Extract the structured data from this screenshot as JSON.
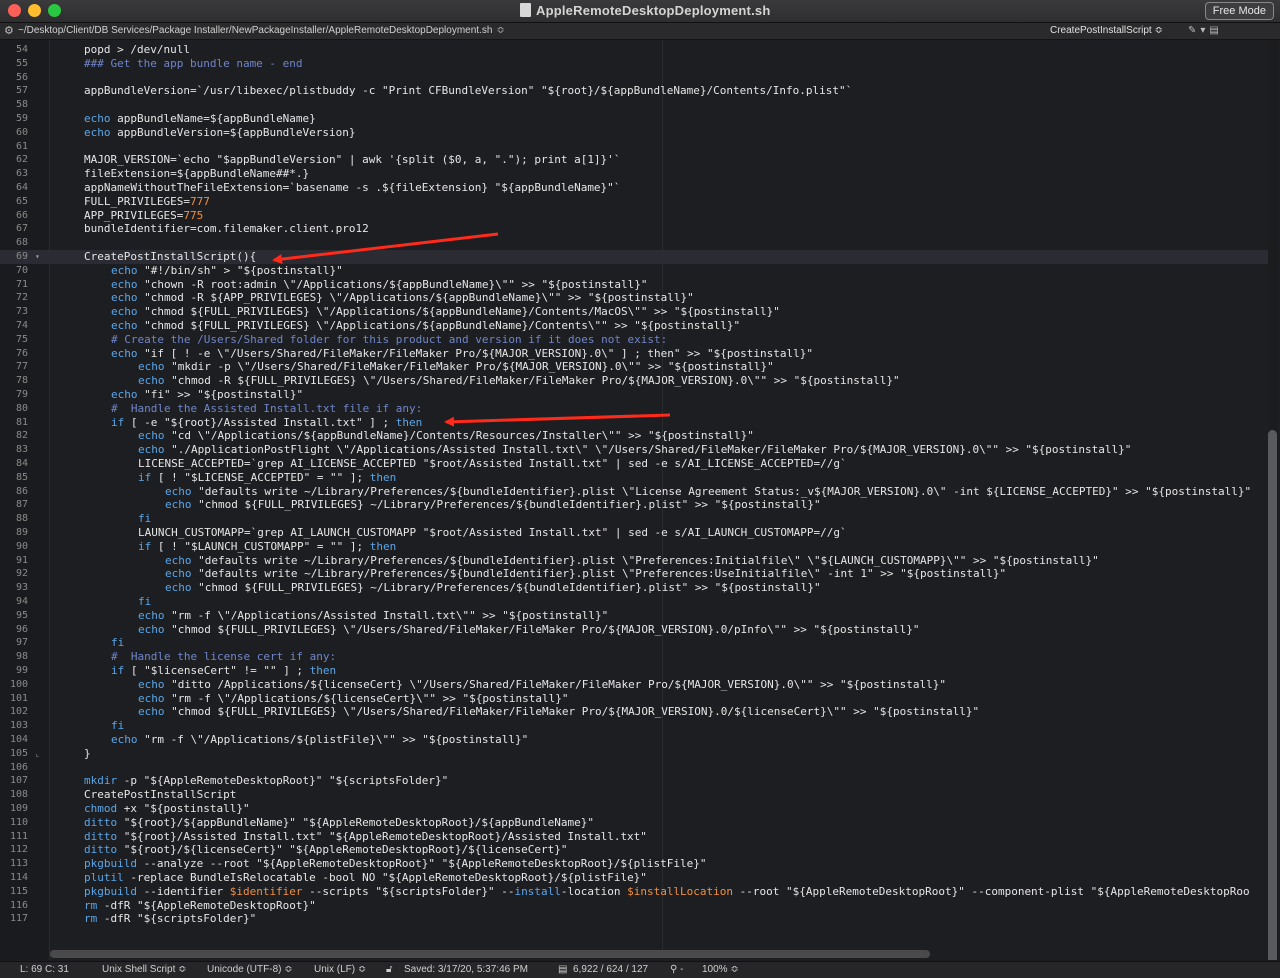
{
  "window": {
    "title": "AppleRemoteDesktopDeployment.sh",
    "free_mode_label": "Free Mode",
    "colors": {
      "close": "#fe5f57",
      "minimize": "#febc2e",
      "maximize": "#28c840"
    }
  },
  "pathbar": {
    "path": "~/Desktop/Client/DB Services/Package Installer/NewPackageInstaller/AppleRemoteDesktopDeployment.sh",
    "function_menu": "CreatePostInstallScript",
    "icons": [
      "gear-icon",
      "bookmark-icon",
      "text-options-icon",
      "split-view-icon"
    ]
  },
  "editor": {
    "current_line": 69,
    "syntax_colors": {
      "keyword": "#5aa6e8",
      "comment": "#6f86c9",
      "number": "#f2903a",
      "text": "#cfcfcf"
    },
    "lines": [
      {
        "n": 54,
        "i": 2,
        "segs": [
          [
            "p",
            "popd > /dev/null"
          ]
        ]
      },
      {
        "n": 55,
        "i": 2,
        "segs": [
          [
            "c",
            "### Get the app bundle name - end"
          ]
        ]
      },
      {
        "n": 56,
        "i": 2,
        "segs": []
      },
      {
        "n": 57,
        "i": 2,
        "segs": [
          [
            "p",
            "appBundleVersion=`/usr/libexec/plistbuddy -c \"Print CFBundleVersion\" \"${root}/${appBundleName}/Contents/Info.plist\"`"
          ]
        ]
      },
      {
        "n": 58,
        "i": 2,
        "segs": []
      },
      {
        "n": 59,
        "i": 2,
        "segs": [
          [
            "k",
            "echo"
          ],
          [
            "p",
            " appBundleName=${appBundleName}"
          ]
        ]
      },
      {
        "n": 60,
        "i": 2,
        "segs": [
          [
            "k",
            "echo"
          ],
          [
            "p",
            " appBundleVersion=${appBundleVersion}"
          ]
        ]
      },
      {
        "n": 61,
        "i": 2,
        "segs": []
      },
      {
        "n": 62,
        "i": 2,
        "segs": [
          [
            "p",
            "MAJOR_VERSION=`echo \"$appBundleVersion\" | awk '{split ($0, a, \".\"); print a[1]}'`"
          ]
        ]
      },
      {
        "n": 63,
        "i": 2,
        "segs": [
          [
            "p",
            "fileExtension=${appBundleName##*.}"
          ]
        ]
      },
      {
        "n": 64,
        "i": 2,
        "segs": [
          [
            "p",
            "appNameWithoutTheFileExtension=`basename -s .${fileExtension} \"${appBundleName}\"`"
          ]
        ]
      },
      {
        "n": 65,
        "i": 2,
        "segs": [
          [
            "p",
            "FULL_PRIVILEGES="
          ],
          [
            "n",
            "777"
          ]
        ]
      },
      {
        "n": 66,
        "i": 2,
        "segs": [
          [
            "p",
            "APP_PRIVILEGES="
          ],
          [
            "n",
            "775"
          ]
        ]
      },
      {
        "n": 67,
        "i": 2,
        "segs": [
          [
            "p",
            "bundleIdentifier=com.filemaker.client.pro12"
          ]
        ]
      },
      {
        "n": 68,
        "i": 2,
        "segs": []
      },
      {
        "n": 69,
        "i": 2,
        "fold": "▾",
        "segs": [
          [
            "p",
            "CreatePostInstallScript(){"
          ]
        ]
      },
      {
        "n": 70,
        "i": 3,
        "segs": [
          [
            "k",
            "echo"
          ],
          [
            "p",
            " \"#!/bin/sh\" > \"${postinstall}\""
          ]
        ]
      },
      {
        "n": 71,
        "i": 3,
        "segs": [
          [
            "k",
            "echo"
          ],
          [
            "p",
            " \"chown -R root:admin \\\"/Applications/${appBundleName}\\\"\" >> \"${postinstall}\""
          ]
        ]
      },
      {
        "n": 72,
        "i": 3,
        "segs": [
          [
            "k",
            "echo"
          ],
          [
            "p",
            " \"chmod -R ${APP_PRIVILEGES} \\\"/Applications/${appBundleName}\\\"\" >> \"${postinstall}\""
          ]
        ]
      },
      {
        "n": 73,
        "i": 3,
        "segs": [
          [
            "k",
            "echo"
          ],
          [
            "p",
            " \"chmod ${FULL_PRIVILEGES} \\\"/Applications/${appBundleName}/Contents/MacOS\\\"\" >> \"${postinstall}\""
          ]
        ]
      },
      {
        "n": 74,
        "i": 3,
        "segs": [
          [
            "k",
            "echo"
          ],
          [
            "p",
            " \"chmod ${FULL_PRIVILEGES} \\\"/Applications/${appBundleName}/Contents\\\"\" >> \"${postinstall}\""
          ]
        ]
      },
      {
        "n": 75,
        "i": 3,
        "segs": [
          [
            "c",
            "# Create the /Users/Shared folder for this product and version if it does not exist:"
          ]
        ]
      },
      {
        "n": 76,
        "i": 3,
        "segs": [
          [
            "k",
            "echo"
          ],
          [
            "p",
            " \"if [ ! -e \\\"/Users/Shared/FileMaker/FileMaker Pro/${MAJOR_VERSION}.0\\\" ] ; then\" >> \"${postinstall}\""
          ]
        ]
      },
      {
        "n": 77,
        "i": 4,
        "segs": [
          [
            "k",
            "echo"
          ],
          [
            "p",
            " \"mkdir -p \\\"/Users/Shared/FileMaker/FileMaker Pro/${MAJOR_VERSION}.0\\\"\" >> \"${postinstall}\""
          ]
        ]
      },
      {
        "n": 78,
        "i": 4,
        "segs": [
          [
            "k",
            "echo"
          ],
          [
            "p",
            " \"chmod -R ${FULL_PRIVILEGES} \\\"/Users/Shared/FileMaker/FileMaker Pro/${MAJOR_VERSION}.0\\\"\" >> \"${postinstall}\""
          ]
        ]
      },
      {
        "n": 79,
        "i": 3,
        "segs": [
          [
            "k",
            "echo"
          ],
          [
            "p",
            " \"fi\" >> \"${postinstall}\""
          ]
        ]
      },
      {
        "n": 80,
        "i": 3,
        "segs": [
          [
            "c",
            "#  Handle the Assisted Install.txt file if any:"
          ]
        ]
      },
      {
        "n": 81,
        "i": 3,
        "segs": [
          [
            "k",
            "if"
          ],
          [
            "p",
            " [ -e \"${root}/Assisted Install.txt\" ] ; "
          ],
          [
            "k",
            "then"
          ]
        ]
      },
      {
        "n": 82,
        "i": 4,
        "segs": [
          [
            "k",
            "echo"
          ],
          [
            "p",
            " \"cd \\\"/Applications/${appBundleName}/Contents/Resources/Installer\\\"\" >> \"${postinstall}\""
          ]
        ]
      },
      {
        "n": 83,
        "i": 4,
        "segs": [
          [
            "k",
            "echo"
          ],
          [
            "p",
            " \"./ApplicationPostFlight \\\"/Applications/Assisted Install.txt\\\" \\\"/Users/Shared/FileMaker/FileMaker Pro/${MAJOR_VERSION}.0\\\"\" >> \"${postinstall}\""
          ]
        ]
      },
      {
        "n": 84,
        "i": 4,
        "segs": [
          [
            "p",
            "LICENSE_ACCEPTED=`grep AI_LICENSE_ACCEPTED \"$root/Assisted Install.txt\" | sed -e s/AI_LICENSE_ACCEPTED=//g`"
          ]
        ]
      },
      {
        "n": 85,
        "i": 4,
        "segs": [
          [
            "k",
            "if"
          ],
          [
            "p",
            " [ ! \"$LICENSE_ACCEPTED\" = \"\" ]; "
          ],
          [
            "k",
            "then"
          ]
        ]
      },
      {
        "n": 86,
        "i": 5,
        "segs": [
          [
            "k",
            "echo"
          ],
          [
            "p",
            " \"defaults write ~/Library/Preferences/${bundleIdentifier}.plist \\\"License Agreement Status:_v${MAJOR_VERSION}.0\\\" -int ${LICENSE_ACCEPTED}\" >> \"${postinstall}\""
          ]
        ]
      },
      {
        "n": 87,
        "i": 5,
        "segs": [
          [
            "k",
            "echo"
          ],
          [
            "p",
            " \"chmod ${FULL_PRIVILEGES} ~/Library/Preferences/${bundleIdentifier}.plist\" >> \"${postinstall}\""
          ]
        ]
      },
      {
        "n": 88,
        "i": 4,
        "segs": [
          [
            "k",
            "fi"
          ]
        ]
      },
      {
        "n": 89,
        "i": 4,
        "segs": [
          [
            "p",
            "LAUNCH_CUSTOMAPP=`grep AI_LAUNCH_CUSTOMAPP \"$root/Assisted Install.txt\" | sed -e s/AI_LAUNCH_CUSTOMAPP=//g`"
          ]
        ]
      },
      {
        "n": 90,
        "i": 4,
        "segs": [
          [
            "k",
            "if"
          ],
          [
            "p",
            " [ ! \"$LAUNCH_CUSTOMAPP\" = \"\" ]; "
          ],
          [
            "k",
            "then"
          ]
        ]
      },
      {
        "n": 91,
        "i": 5,
        "segs": [
          [
            "k",
            "echo"
          ],
          [
            "p",
            " \"defaults write ~/Library/Preferences/${bundleIdentifier}.plist \\\"Preferences:Initialfile\\\" \\\"${LAUNCH_CUSTOMAPP}\\\"\" >> \"${postinstall}\""
          ]
        ]
      },
      {
        "n": 92,
        "i": 5,
        "segs": [
          [
            "k",
            "echo"
          ],
          [
            "p",
            " \"defaults write ~/Library/Preferences/${bundleIdentifier}.plist \\\"Preferences:UseInitialfile\\\" -int 1\" >> \"${postinstall}\""
          ]
        ]
      },
      {
        "n": 93,
        "i": 5,
        "segs": [
          [
            "k",
            "echo"
          ],
          [
            "p",
            " \"chmod ${FULL_PRIVILEGES} ~/Library/Preferences/${bundleIdentifier}.plist\" >> \"${postinstall}\""
          ]
        ]
      },
      {
        "n": 94,
        "i": 4,
        "segs": [
          [
            "k",
            "fi"
          ]
        ]
      },
      {
        "n": 95,
        "i": 4,
        "segs": [
          [
            "k",
            "echo"
          ],
          [
            "p",
            " \"rm -f \\\"/Applications/Assisted Install.txt\\\"\" >> \"${postinstall}\""
          ]
        ]
      },
      {
        "n": 96,
        "i": 4,
        "segs": [
          [
            "k",
            "echo"
          ],
          [
            "p",
            " \"chmod ${FULL_PRIVILEGES} \\\"/Users/Shared/FileMaker/FileMaker Pro/${MAJOR_VERSION}.0/pInfo\\\"\" >> \"${postinstall}\""
          ]
        ]
      },
      {
        "n": 97,
        "i": 3,
        "segs": [
          [
            "k",
            "fi"
          ]
        ]
      },
      {
        "n": 98,
        "i": 3,
        "segs": [
          [
            "c",
            "#  Handle the license cert if any:"
          ]
        ]
      },
      {
        "n": 99,
        "i": 3,
        "segs": [
          [
            "k",
            "if"
          ],
          [
            "p",
            " [ \"$licenseCert\" != \"\" ] ; "
          ],
          [
            "k",
            "then"
          ]
        ]
      },
      {
        "n": 100,
        "i": 4,
        "segs": [
          [
            "k",
            "echo"
          ],
          [
            "p",
            " \"ditto /Applications/${licenseCert} \\\"/Users/Shared/FileMaker/FileMaker Pro/${MAJOR_VERSION}.0\\\"\" >> \"${postinstall}\""
          ]
        ]
      },
      {
        "n": 101,
        "i": 4,
        "segs": [
          [
            "k",
            "echo"
          ],
          [
            "p",
            " \"rm -f \\\"/Applications/${licenseCert}\\\"\" >> \"${postinstall}\""
          ]
        ]
      },
      {
        "n": 102,
        "i": 4,
        "segs": [
          [
            "k",
            "echo"
          ],
          [
            "p",
            " \"chmod ${FULL_PRIVILEGES} \\\"/Users/Shared/FileMaker/FileMaker Pro/${MAJOR_VERSION}.0/${licenseCert}\\\"\" >> \"${postinstall}\""
          ]
        ]
      },
      {
        "n": 103,
        "i": 3,
        "segs": [
          [
            "k",
            "fi"
          ]
        ]
      },
      {
        "n": 104,
        "i": 3,
        "segs": [
          [
            "k",
            "echo"
          ],
          [
            "p",
            " \"rm -f \\\"/Applications/${plistFile}\\\"\" >> \"${postinstall}\""
          ]
        ]
      },
      {
        "n": 105,
        "i": 2,
        "fold": "⌞",
        "segs": [
          [
            "p",
            "}"
          ]
        ]
      },
      {
        "n": 106,
        "i": 2,
        "segs": []
      },
      {
        "n": 107,
        "i": 2,
        "segs": [
          [
            "k",
            "mkdir"
          ],
          [
            "p",
            " -p \"${AppleRemoteDesktopRoot}\" \"${scriptsFolder}\""
          ]
        ]
      },
      {
        "n": 108,
        "i": 2,
        "segs": [
          [
            "p",
            "CreatePostInstallScript"
          ]
        ]
      },
      {
        "n": 109,
        "i": 2,
        "segs": [
          [
            "k",
            "chmod"
          ],
          [
            "p",
            " +x \"${postinstall}\""
          ]
        ]
      },
      {
        "n": 110,
        "i": 2,
        "segs": [
          [
            "k",
            "ditto"
          ],
          [
            "p",
            " \"${root}/${appBundleName}\" \"${AppleRemoteDesktopRoot}/${appBundleName}\""
          ]
        ]
      },
      {
        "n": 111,
        "i": 2,
        "segs": [
          [
            "k",
            "ditto"
          ],
          [
            "p",
            " \"${root}/Assisted Install.txt\" \"${AppleRemoteDesktopRoot}/Assisted Install.txt\""
          ]
        ]
      },
      {
        "n": 112,
        "i": 2,
        "segs": [
          [
            "k",
            "ditto"
          ],
          [
            "p",
            " \"${root}/${licenseCert}\" \"${AppleRemoteDesktopRoot}/${licenseCert}\""
          ]
        ]
      },
      {
        "n": 113,
        "i": 2,
        "segs": [
          [
            "k",
            "pkgbuild"
          ],
          [
            "p",
            " --analyze --root \"${AppleRemoteDesktopRoot}\" \"${AppleRemoteDesktopRoot}/${plistFile}\""
          ]
        ]
      },
      {
        "n": 114,
        "i": 2,
        "segs": [
          [
            "k",
            "plutil"
          ],
          [
            "p",
            " -replace BundleIsRelocatable -bool NO \"${AppleRemoteDesktopRoot}/${plistFile}\""
          ]
        ]
      },
      {
        "n": 115,
        "i": 2,
        "segs": [
          [
            "k",
            "pkgbuild"
          ],
          [
            "p",
            " --identifier "
          ],
          [
            "n",
            "$identifier"
          ],
          [
            "p",
            " --scripts \"${scriptsFolder}\" --"
          ],
          [
            "k",
            "install"
          ],
          [
            "p",
            "-location "
          ],
          [
            "n",
            "$installLocation"
          ],
          [
            "p",
            " --root \"${AppleRemoteDesktopRoot}\" --component-plist \"${AppleRemoteDesktopRoo"
          ]
        ]
      },
      {
        "n": 116,
        "i": 2,
        "segs": [
          [
            "k",
            "rm"
          ],
          [
            "p",
            " -dfR \"${AppleRemoteDesktopRoot}\""
          ]
        ]
      },
      {
        "n": 117,
        "i": 2,
        "segs": [
          [
            "k",
            "rm"
          ],
          [
            "p",
            " -dfR \"${scriptsFolder}\""
          ]
        ]
      }
    ]
  },
  "statusbar": {
    "position": "L: 69 C: 31",
    "language": "Unix Shell Script ≎",
    "encoding": "Unicode (UTF-8) ≎",
    "line_endings": "Unix (LF) ≎",
    "saved": "Saved: 3/17/20, 5:37:46 PM",
    "stats": "6,922 / 624 / 127",
    "zoom": "100% ≎"
  }
}
